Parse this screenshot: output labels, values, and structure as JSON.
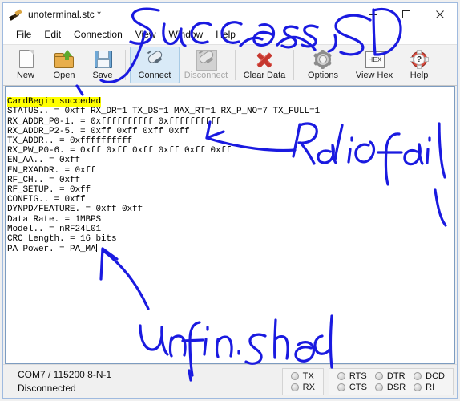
{
  "window": {
    "title": "unoterminal.stc *",
    "app_icon": "brush-icon",
    "controls": {
      "minimize": "−",
      "maximize": "□",
      "close": "✕"
    }
  },
  "menu": {
    "items": [
      {
        "label": "File"
      },
      {
        "label": "Edit"
      },
      {
        "label": "Connection"
      },
      {
        "label": "View"
      },
      {
        "label": "Window"
      },
      {
        "label": "Help"
      }
    ]
  },
  "toolbar": {
    "buttons": [
      {
        "label": "New",
        "icon": "new-document-icon",
        "state": "enabled"
      },
      {
        "label": "Open",
        "icon": "open-folder-icon",
        "state": "enabled"
      },
      {
        "label": "Save",
        "icon": "floppy-disk-icon",
        "state": "enabled"
      },
      {
        "label": "Connect",
        "icon": "plug-connect-icon",
        "state": "hover"
      },
      {
        "label": "Disconnect",
        "icon": "plug-disconnect-icon",
        "state": "disabled"
      },
      {
        "label": "Clear Data",
        "icon": "red-x-icon",
        "state": "enabled"
      },
      {
        "label": "Options",
        "icon": "gear-icon",
        "state": "enabled"
      },
      {
        "label": "View Hex",
        "icon": "hex-icon",
        "state": "enabled"
      },
      {
        "label": "Help",
        "icon": "lifebuoy-help-icon",
        "state": "enabled"
      }
    ],
    "hex_icon_text": "HEX",
    "help_icon_glyph": "?"
  },
  "terminal": {
    "highlight_color": "#ffff00",
    "highlighted_line": "CardBegin succeded",
    "lines": [
      "STATUS.. = 0xff RX_DR=1 TX_DS=1 MAX_RT=1 RX_P_NO=7 TX_FULL=1",
      "RX_ADDR_P0-1. = 0xffffffffff 0xffffffffff",
      "RX_ADDR_P2-5. = 0xff 0xff 0xff 0xff",
      "TX_ADDR.. = 0xffffffffff",
      "RX_PW_P0-6. = 0xff 0xff 0xff 0xff 0xff 0xff",
      "EN_AA.. = 0xff",
      "EN_RXADDR. = 0xff",
      "RF_CH.. = 0xff",
      "RF_SETUP. = 0xff",
      "CONFIG.. = 0xff",
      "DYNPD/FEATURE. = 0xff 0xff",
      "Data Rate. = 1MBPS",
      "Model.. = nRF24L01",
      "CRC Length. = 16 bits"
    ],
    "last_line": "PA Power. = PA_MA"
  },
  "statusbar": {
    "port_line": "COM7 / 115200 8-N-1",
    "connection_state": "Disconnected",
    "led_groups": [
      {
        "leds": [
          {
            "label": "TX",
            "on": false
          },
          {
            "label": "RX",
            "on": false
          }
        ]
      },
      {
        "leds": [
          {
            "label": "RTS",
            "on": false
          },
          {
            "label": "CTS",
            "on": false
          },
          {
            "label": "DTR",
            "on": false
          },
          {
            "label": "DSR",
            "on": false
          },
          {
            "label": "DCD",
            "on": false
          },
          {
            "label": "RI",
            "on": false
          }
        ]
      }
    ]
  },
  "annotations": {
    "ink_color": "#1a1ae0",
    "notes": [
      {
        "text": "Success SD",
        "position": "top, over menu bar and toolbar"
      },
      {
        "text": "Radio fail",
        "position": "right of terminal, arrow pointing left at register dump"
      },
      {
        "text": "Unfinished",
        "position": "bottom center, arrow pointing up at last line"
      }
    ]
  }
}
